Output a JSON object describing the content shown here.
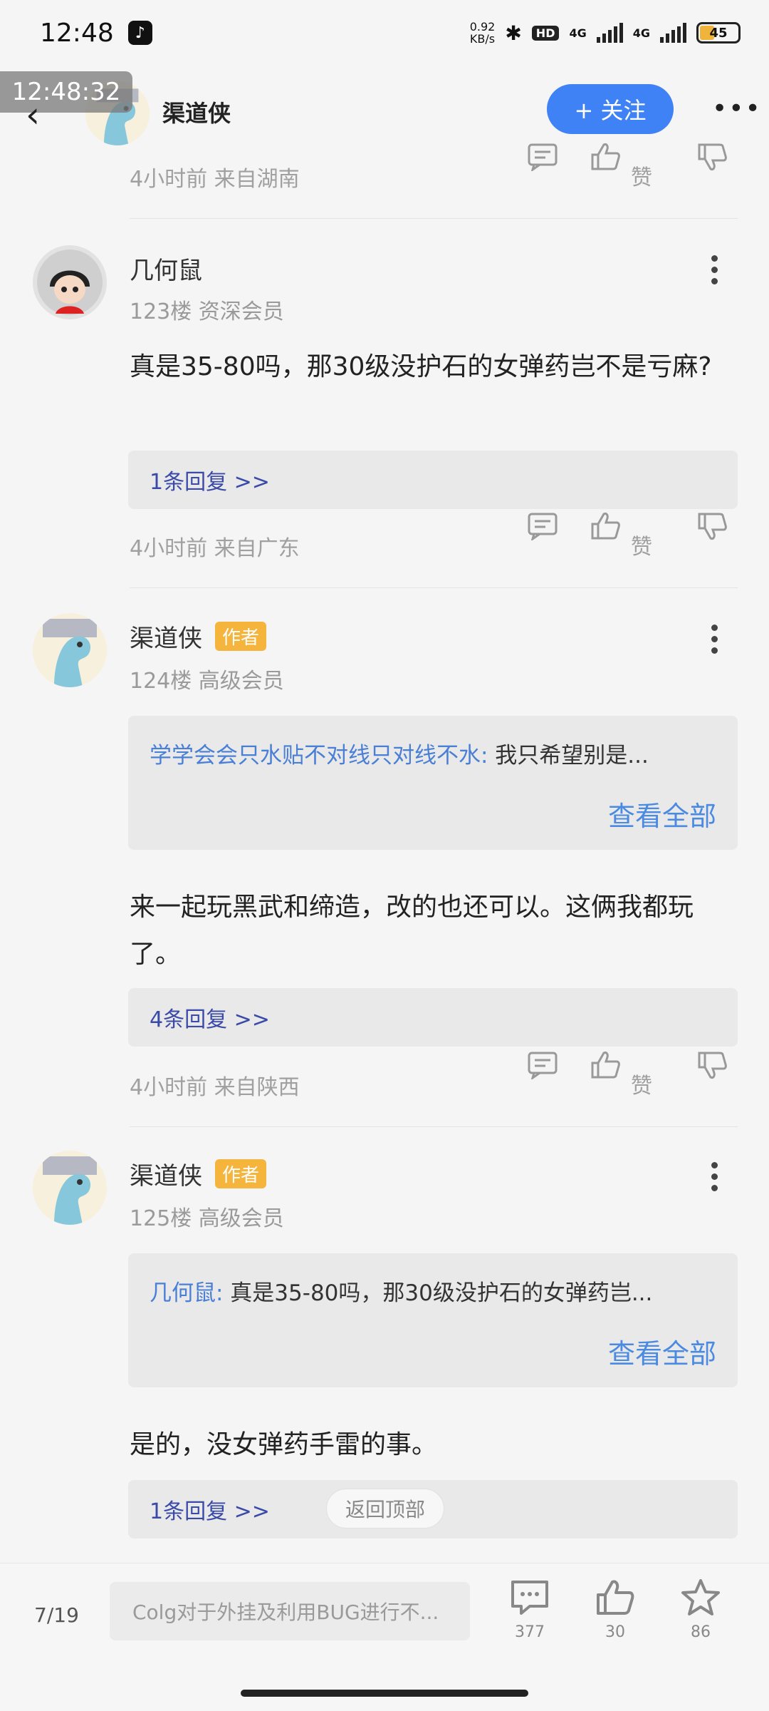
{
  "status_bar": {
    "time": "12:48",
    "net_speed_value": "0.92",
    "net_speed_unit": "KB/s",
    "hd_label": "HD",
    "sim1": "4G",
    "sim2": "4G",
    "battery": "45"
  },
  "overlay_time": "12:48:32",
  "header": {
    "author_name": "渠道侠",
    "follow_label": "+ 关注"
  },
  "colors": {
    "accent_blue": "#3f82f5",
    "author_badge": "#f5b43c",
    "link_blue": "#4a7fd6",
    "reply_link": "#3a4aa8"
  },
  "partial_comment": {
    "meta": "4小时前 来自湖南",
    "like_label": "赞"
  },
  "comments": [
    {
      "user": "几何鼠",
      "badge": "",
      "floor": "123楼 资深会员",
      "text": "真是35-80吗，那30级没护石的女弹药岂不是亏麻?",
      "replies": "1条回复 >>",
      "meta": "4小时前 来自广东",
      "like_label": "赞"
    },
    {
      "user": "渠道侠",
      "badge": "作者",
      "floor": "124楼 高级会员",
      "quote_user": "学学会会只水贴不对线只对线不水:",
      "quote_text": " 我只希望别是...",
      "view_all": "查看全部",
      "text": "来一起玩黑武和缔造，改的也还可以。这俩我都玩了。",
      "replies": "4条回复 >>",
      "meta": "4小时前 来自陕西",
      "like_label": "赞"
    },
    {
      "user": "渠道侠",
      "badge": "作者",
      "floor": "125楼 高级会员",
      "quote_user": "几何鼠:",
      "quote_text": " 真是35-80吗，那30级没护石的女弹药岂...",
      "view_all": "查看全部",
      "text": "是的，没女弹药手雷的事。",
      "replies": "1条回复 >>"
    }
  ],
  "back_to_top": "返回顶部",
  "bottom_bar": {
    "page": "7/19",
    "input_placeholder": "Colg对于外挂及利用BUG进行不...",
    "comments_count": "377",
    "likes_count": "30",
    "favorites_count": "86"
  }
}
